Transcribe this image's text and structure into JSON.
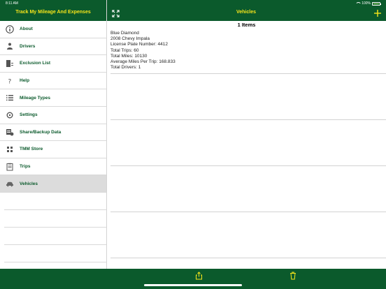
{
  "status_bar": {
    "time": "8:11 AM",
    "battery_text": "100%"
  },
  "header": {
    "left_title": "Track My Mileage And Expenses",
    "right_title": "Vehicles"
  },
  "sidebar": {
    "items": [
      {
        "label": "About",
        "icon": "info-icon"
      },
      {
        "label": "Drivers",
        "icon": "driver-icon"
      },
      {
        "label": "Exclusion List",
        "icon": "exclusion-list-icon"
      },
      {
        "label": "Help",
        "icon": "help-icon"
      },
      {
        "label": "Mileage Types",
        "icon": "list-icon"
      },
      {
        "label": "Settings",
        "icon": "gear-icon"
      },
      {
        "label": "Share/Backup Data",
        "icon": "share-backup-icon"
      },
      {
        "label": "TMM Store",
        "icon": "store-icon"
      },
      {
        "label": "Trips",
        "icon": "trips-icon"
      },
      {
        "label": "Vehicles",
        "icon": "car-icon",
        "selected": true
      }
    ]
  },
  "main": {
    "items_count": "1 Items",
    "vehicle": {
      "name": "Blue Diamond",
      "model": "2008 Chevy Impala",
      "license": "License Plate Number: 4412",
      "total_trips": "Total Trips: 60",
      "total_miles": "Total Miles: 10130",
      "avg_miles": "Average Miles Per Trip: 168.833",
      "total_drivers": "Total Drivers: 1"
    }
  },
  "colors": {
    "header_green": "#0b5a2c",
    "title_yellow": "#f7e51a",
    "selected_row": "#dcdcdc"
  }
}
